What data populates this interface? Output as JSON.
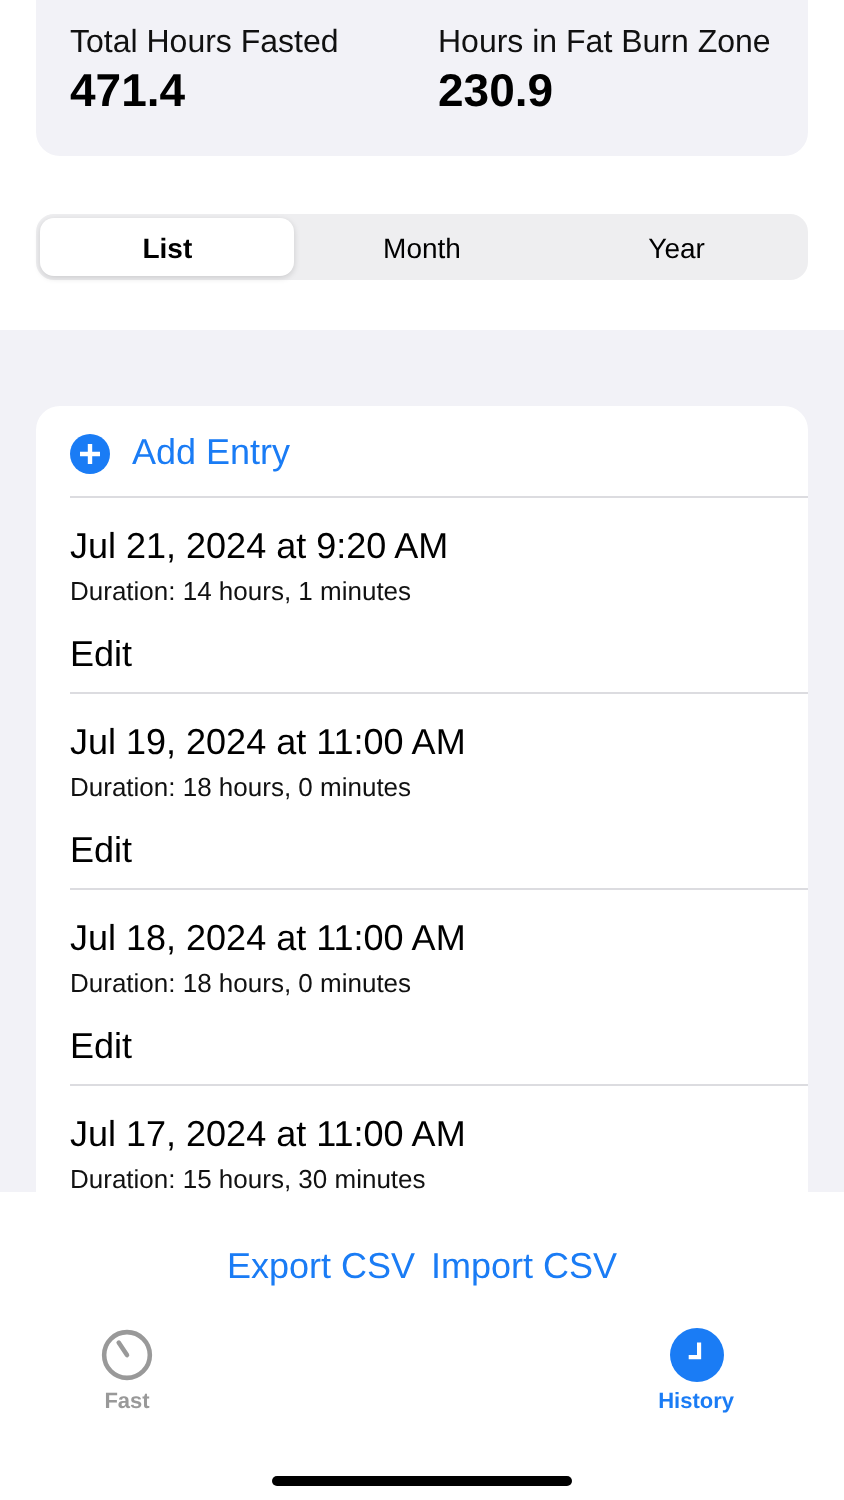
{
  "stats": [
    {
      "label": "Total Hours Fasted",
      "value": "471.4"
    },
    {
      "label": "Hours in Fat Burn Zone",
      "value": "230.9"
    }
  ],
  "segments": [
    {
      "label": "List",
      "selected": true
    },
    {
      "label": "Month",
      "selected": false
    },
    {
      "label": "Year",
      "selected": false
    }
  ],
  "add_entry": "Add Entry",
  "entries": [
    {
      "title": "Jul 21, 2024 at 9:20 AM",
      "duration": "Duration: 14 hours, 1 minutes",
      "action": "Edit"
    },
    {
      "title": "Jul 19, 2024 at 11:00 AM",
      "duration": "Duration: 18 hours, 0 minutes",
      "action": "Edit"
    },
    {
      "title": "Jul 18, 2024 at 11:00 AM",
      "duration": "Duration: 18 hours, 0 minutes",
      "action": "Edit"
    },
    {
      "title": "Jul 17, 2024 at 11:00 AM",
      "duration": "Duration: 15 hours, 30 minutes"
    }
  ],
  "csv_actions": [
    "Export CSV",
    "Import CSV"
  ],
  "tab_bar": [
    {
      "label": "Fast",
      "kind": "timer",
      "selected": false
    },
    {
      "label": "History",
      "kind": "clock",
      "selected": true
    }
  ]
}
